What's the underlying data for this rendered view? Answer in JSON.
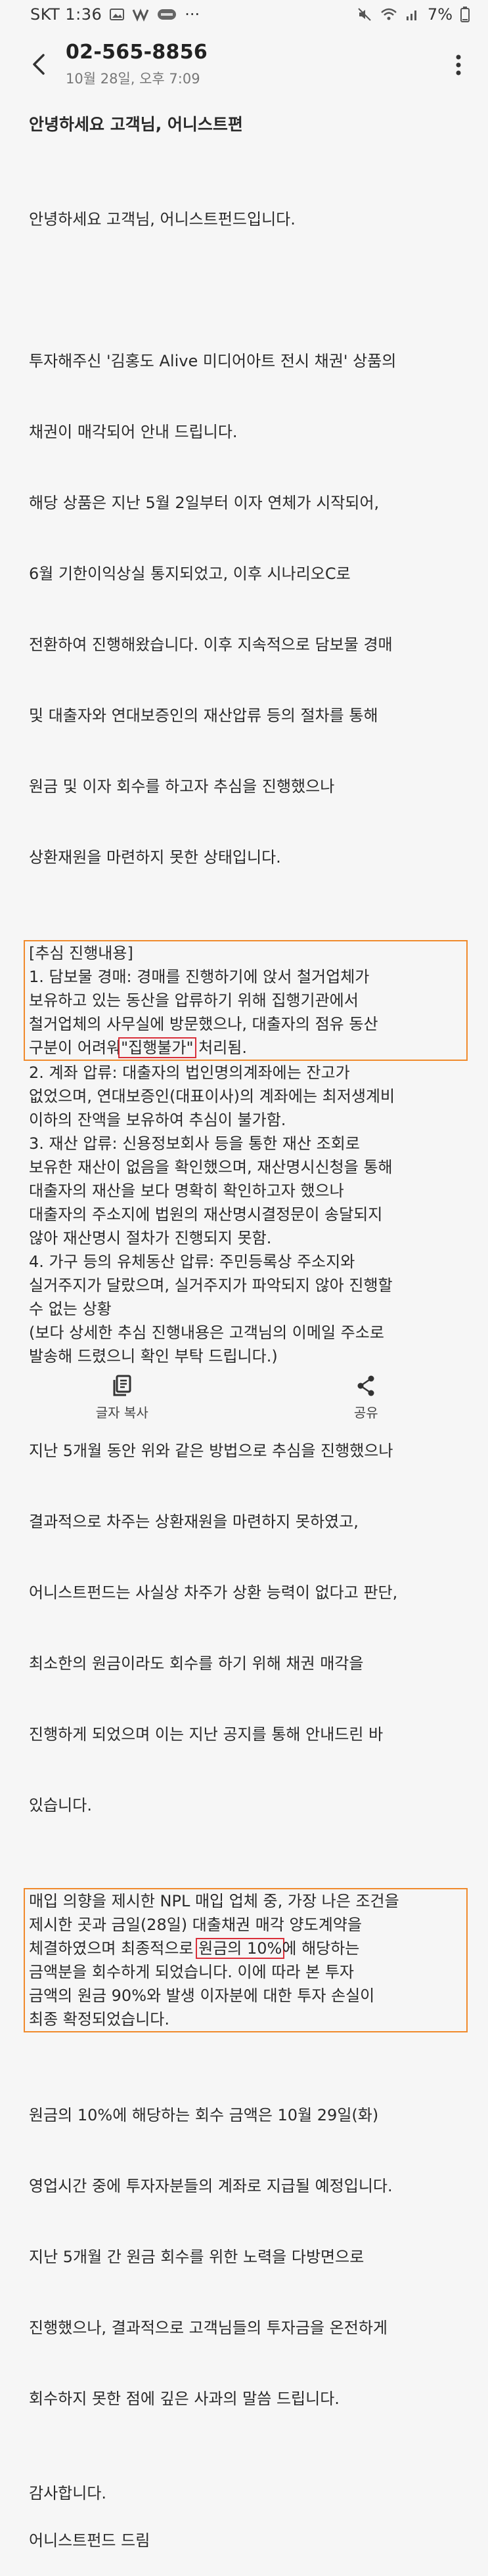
{
  "status_bar": {
    "carrier_time": "SKT 1:36",
    "more": "···",
    "battery": "7%"
  },
  "header": {
    "title": "02-565-8856",
    "subtitle": "10월 28일, 오후 7:09"
  },
  "message": {
    "title": "안녕하세요 고객님, 어니스트편",
    "greeting": "안녕하세요 고객님, 어니스트펀드입니다.",
    "intro": [
      "투자해주신 '김홍도 Alive 미디어아트 전시 채권' 상품의",
      "채권이 매각되어 안내 드립니다.",
      "해당 상품은 지난 5월 2일부터 이자 연체가 시작되어,",
      "6월 기한이익상실 통지되었고, 이후 시나리오C로",
      "전환하여 진행해왔습니다. 이후 지속적으로 담보물 경매",
      "및 대출자와 연대보증인의 재산압류 등의 절차를 통해",
      "원금 및 이자 회수를 하고자 추심을 진행했으나",
      "상환재원을 마련하지 못한 상태입니다."
    ],
    "box1": {
      "lines": [
        "[추심 진행내용]",
        "1. 담보물 경매: 경매를 진행하기에 앉서 철거업체가",
        "보유하고 있는 동산을 압류하기 위해 집행기관에서",
        "철거업체의 사무실에 방문했으나, 대출자의 점유 동산"
      ],
      "last_before": "구분이 어려워",
      "last_highlight": "\"집행불가\"",
      "last_after": " 처리됨."
    },
    "process_rest": [
      "2. 계좌 압류: 대출자의 법인명의계좌에는 잔고가",
      "없었으며, 연대보증인(대표이사)의 계좌에는 최저생계비",
      "이하의 잔액을 보유하여 추심이 불가함.",
      "3. 재산 압류: 신용정보회사 등을 통한 재산 조회로",
      "보유한 재산이 없음을 확인했으며, 재산명시신청을 통해",
      "대출자의 재산을 보다 명확히 확인하고자 했으나",
      "대출자의 주소지에 법원의 재산명시결정문이 송달되지",
      "않아 재산명시 절차가 진행되지 못함.",
      "4. 가구 등의 유체동산 압류: 주민등록상 주소지와",
      "실거주지가 달랐으며, 실거주지가 파악되지 않아 진행할",
      "수 없는 상황",
      "(보다 상세한 추심 진행내용은 고객님의 이메일 주소로",
      "발송해 드렸으니 확인 부탁 드립니다.)"
    ],
    "para_5months": [
      "지난 5개월 동안 위와 같은 방법으로 추심을 진행했으나",
      "결과적으로 차주는 상환재원을 마련하지 못하였고,",
      "어니스트펀드는 사실상 차주가 상환 능력이 없다고 판단,",
      "최소한의 원금이라도 회수를 하기 위해 채권 매각을",
      "진행하게 되었으며 이는 지난 공지를 통해 안내드린 바",
      "있습니다."
    ],
    "box2": {
      "line1": "매입 의향을 제시한 NPL 매입 업체 중, 가장 나은 조건을",
      "line2": "제시한 곳과 금일(28일) 대출채권 매각 양도계약을",
      "line3_before": "체결하였으며 최종적으로 ",
      "line3_highlight": "원금의 10%",
      "line3_after": "에 해당하는",
      "line4": "금액분을 회수하게 되었습니다. 이에 따라 본 투자",
      "line5": "금액의 원금 90%와 발생 이자분에 대한 투자 손실이",
      "line6": "최종 확정되었습니다."
    },
    "para_refund": [
      "원금의 10%에 해당하는 회수 금액은 10월 29일(화)",
      "영업시간 중에 투자자분들의 계좌로 지급될 예정입니다.",
      "지난 5개월 간 원금 회수를 위한 노력을 다방면으로",
      "진행했으나, 결과적으로 고객님들의 투자금을 온전하게",
      "회수하지 못한 점에 깊은 사과의 말씀 드립니다."
    ],
    "thanks": "감사합니다.",
    "signature": "어니스트펀드 드림"
  },
  "bottom_bar": {
    "copy_label": "글자 복사",
    "share_label": "공유"
  },
  "colors": {
    "box_border": "#f08a2c",
    "highlight_border": "#d9303a",
    "background": "#f6f6f6"
  }
}
